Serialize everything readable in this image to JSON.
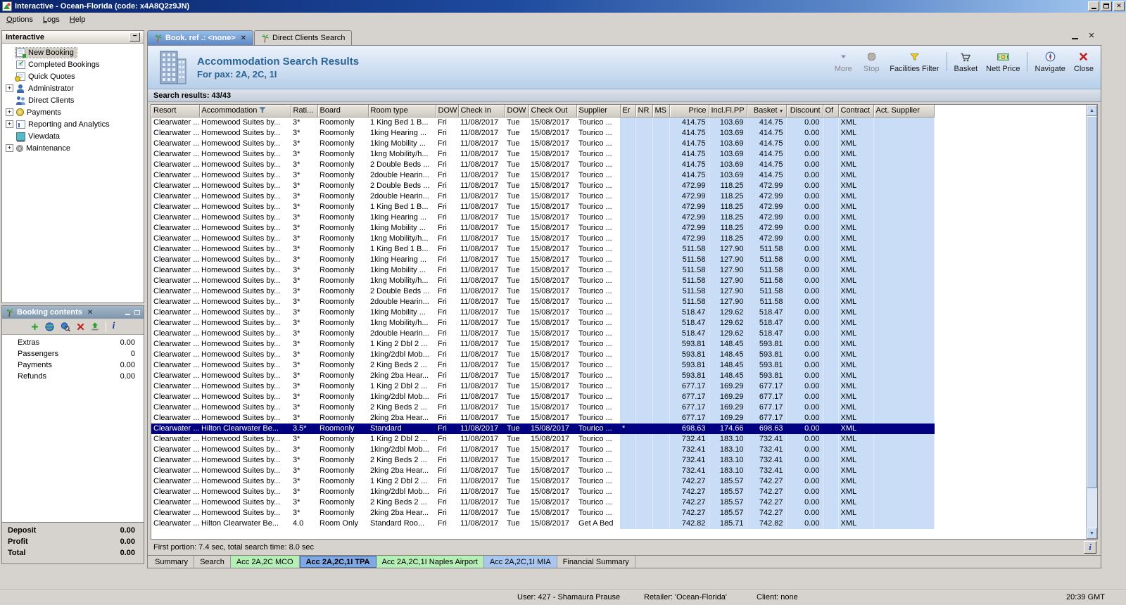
{
  "window": {
    "title": "Interactive - Ocean-Florida (code: x4A8Q2z9JN)"
  },
  "menu": {
    "items": [
      {
        "label": "Options"
      },
      {
        "label": "Logs"
      },
      {
        "label": "Help"
      }
    ]
  },
  "sidebar": {
    "title": "Interactive",
    "items": [
      {
        "label": "New Booking",
        "icon": "booking-form",
        "expandable": false,
        "selected": true
      },
      {
        "label": "Completed Bookings",
        "icon": "completed-form",
        "expandable": false
      },
      {
        "label": "Quick Quotes",
        "icon": "quote-form",
        "expandable": false
      },
      {
        "label": "Administrator",
        "icon": "person",
        "expandable": true
      },
      {
        "label": "Direct Clients",
        "icon": "people",
        "expandable": false
      },
      {
        "label": "Payments",
        "icon": "coin",
        "expandable": true
      },
      {
        "label": "Reporting and Analytics",
        "icon": "chart",
        "expandable": true
      },
      {
        "label": "Viewdata",
        "icon": "monitor",
        "expandable": false
      },
      {
        "label": "Maintenance",
        "icon": "tools",
        "expandable": true
      }
    ]
  },
  "booking": {
    "title": "Booking contents",
    "rows": [
      {
        "label": "Extras",
        "value": "0.00"
      },
      {
        "label": "Passengers",
        "value": "0"
      },
      {
        "label": "Payments",
        "value": "0.00"
      },
      {
        "label": "Refunds",
        "value": "0.00"
      }
    ],
    "totals": [
      {
        "label": "Deposit",
        "value": "0.00"
      },
      {
        "label": "Profit",
        "value": "0.00"
      },
      {
        "label": "Total",
        "value": "0.00"
      }
    ]
  },
  "doc_tabs": {
    "tabs": [
      {
        "label": "Book. ref .: <none>",
        "active": true,
        "closable": true
      },
      {
        "label": "Direct Clients Search",
        "active": false
      }
    ]
  },
  "results": {
    "title": "Accommodation Search Results",
    "subtitle": "For pax: 2A, 2C, 1I",
    "toolbar": [
      {
        "label": "More",
        "disabled": true
      },
      {
        "label": "Stop",
        "disabled": true
      },
      {
        "label": "Facilities Filter",
        "disabled": false
      },
      {
        "label": "Basket",
        "disabled": false
      },
      {
        "label": "Nett Price",
        "disabled": false
      },
      {
        "label": "Navigate",
        "disabled": false
      },
      {
        "label": "Close",
        "disabled": false
      }
    ],
    "summary": "Search results: 43/43",
    "status_line": "First portion: 7.4 sec, total search time: 8.0 sec"
  },
  "icons": {
    "more": "down-arrow",
    "stop": "gray-octagon",
    "facilities_filter": "yellow-funnel",
    "basket": "shopping-cart",
    "nett_price": "banknote",
    "navigate": "compass",
    "close": "red-x",
    "accommodation_header": "filter-funnel",
    "basket_header": "sort-arrow-down",
    "booking_toolbar": [
      "green-plus",
      "globe",
      "globe-search",
      "red-x",
      "export-up-arrow",
      "info-i"
    ],
    "doc_tab": "palm-tree",
    "results_header": "building"
  },
  "table": {
    "columns": [
      "Resort",
      "Accommodation",
      "Rati...",
      "Board",
      "Room type",
      "DOW",
      "Check In",
      "DOW",
      "Check Out",
      "Supplier",
      "Er",
      "NR",
      "MS",
      "Price",
      "Incl.Fl.PP",
      "Basket",
      "Discount",
      "Of",
      "Contract",
      "Act. Supplier"
    ],
    "row_defaults": {
      "resort": "Clearwater ...",
      "accommodation": "Homewood Suites by...",
      "rating": "3*",
      "board": "Roomonly",
      "dow_in": "Fri",
      "check_in": "11/08/2017",
      "dow_out": "Tue",
      "check_out": "15/08/2017",
      "supplier": "Tourico ...",
      "er": "",
      "nr": "",
      "ms": "",
      "discount": "0.00",
      "of": "",
      "contract": "XML",
      "act_supplier": ""
    },
    "selected_index": 29,
    "rows": [
      {
        "room": "1 King Bed 1 B...",
        "price": "414.75",
        "incl": "103.69",
        "basket": "414.75"
      },
      {
        "room": "1king Hearing ...",
        "price": "414.75",
        "incl": "103.69",
        "basket": "414.75"
      },
      {
        "room": "1king Mobility ...",
        "price": "414.75",
        "incl": "103.69",
        "basket": "414.75"
      },
      {
        "room": "1kng Mobility/h...",
        "price": "414.75",
        "incl": "103.69",
        "basket": "414.75"
      },
      {
        "room": "2 Double Beds ...",
        "price": "414.75",
        "incl": "103.69",
        "basket": "414.75"
      },
      {
        "room": "2double Hearin...",
        "price": "414.75",
        "incl": "103.69",
        "basket": "414.75"
      },
      {
        "room": "2 Double Beds ...",
        "price": "472.99",
        "incl": "118.25",
        "basket": "472.99"
      },
      {
        "room": "2double Hearin...",
        "price": "472.99",
        "incl": "118.25",
        "basket": "472.99"
      },
      {
        "room": "1 King Bed 1 B...",
        "price": "472.99",
        "incl": "118.25",
        "basket": "472.99"
      },
      {
        "room": "1king Hearing ...",
        "price": "472.99",
        "incl": "118.25",
        "basket": "472.99"
      },
      {
        "room": "1king Mobility ...",
        "price": "472.99",
        "incl": "118.25",
        "basket": "472.99"
      },
      {
        "room": "1kng Mobility/h...",
        "price": "472.99",
        "incl": "118.25",
        "basket": "472.99"
      },
      {
        "room": "1 King Bed 1 B...",
        "price": "511.58",
        "incl": "127.90",
        "basket": "511.58"
      },
      {
        "room": "1king Hearing ...",
        "price": "511.58",
        "incl": "127.90",
        "basket": "511.58"
      },
      {
        "room": "1king Mobility ...",
        "price": "511.58",
        "incl": "127.90",
        "basket": "511.58"
      },
      {
        "room": "1kng Mobility/h...",
        "price": "511.58",
        "incl": "127.90",
        "basket": "511.58"
      },
      {
        "room": "2 Double Beds ...",
        "price": "511.58",
        "incl": "127.90",
        "basket": "511.58"
      },
      {
        "room": "2double Hearin...",
        "price": "511.58",
        "incl": "127.90",
        "basket": "511.58"
      },
      {
        "room": "1king Mobility ...",
        "price": "518.47",
        "incl": "129.62",
        "basket": "518.47"
      },
      {
        "room": "1kng Mobility/h...",
        "price": "518.47",
        "incl": "129.62",
        "basket": "518.47"
      },
      {
        "room": "2double Hearin...",
        "price": "518.47",
        "incl": "129.62",
        "basket": "518.47"
      },
      {
        "room": "1 King 2 Dbl 2 ...",
        "price": "593.81",
        "incl": "148.45",
        "basket": "593.81"
      },
      {
        "room": "1king/2dbl Mob...",
        "price": "593.81",
        "incl": "148.45",
        "basket": "593.81"
      },
      {
        "room": "2 King Beds 2 ...",
        "price": "593.81",
        "incl": "148.45",
        "basket": "593.81"
      },
      {
        "room": "2king 2ba Hear...",
        "price": "593.81",
        "incl": "148.45",
        "basket": "593.81"
      },
      {
        "room": "1 King 2 Dbl 2 ...",
        "price": "677.17",
        "incl": "169.29",
        "basket": "677.17"
      },
      {
        "room": "1king/2dbl Mob...",
        "price": "677.17",
        "incl": "169.29",
        "basket": "677.17"
      },
      {
        "room": "2 King Beds 2 ...",
        "price": "677.17",
        "incl": "169.29",
        "basket": "677.17"
      },
      {
        "room": "2king 2ba Hear...",
        "price": "677.17",
        "incl": "169.29",
        "basket": "677.17"
      },
      {
        "accommodation": "Hilton Clearwater Be...",
        "rating": "3.5*",
        "room": "Standard",
        "er": "*",
        "price": "698.63",
        "incl": "174.66",
        "basket": "698.63"
      },
      {
        "room": "1 King 2 Dbl 2 ...",
        "price": "732.41",
        "incl": "183.10",
        "basket": "732.41"
      },
      {
        "room": "1king/2dbl Mob...",
        "price": "732.41",
        "incl": "183.10",
        "basket": "732.41"
      },
      {
        "room": "2 King Beds 2 ...",
        "price": "732.41",
        "incl": "183.10",
        "basket": "732.41"
      },
      {
        "room": "2king 2ba Hear...",
        "price": "732.41",
        "incl": "183.10",
        "basket": "732.41"
      },
      {
        "room": "1 King 2 Dbl 2 ...",
        "price": "742.27",
        "incl": "185.57",
        "basket": "742.27"
      },
      {
        "room": "1king/2dbl Mob...",
        "price": "742.27",
        "incl": "185.57",
        "basket": "742.27"
      },
      {
        "room": "2 King Beds 2 ...",
        "price": "742.27",
        "incl": "185.57",
        "basket": "742.27"
      },
      {
        "room": "2king 2ba Hear...",
        "price": "742.27",
        "incl": "185.57",
        "basket": "742.27"
      },
      {
        "accommodation": "Hilton Clearwater Be...",
        "rating": "4.0",
        "board": "Room Only",
        "room": "Standard Roo...",
        "supplier": "Get A Bed",
        "price": "742.82",
        "incl": "185.71",
        "basket": "742.82"
      }
    ]
  },
  "bottom_tabs": {
    "tabs": [
      {
        "label": "Summary",
        "style": "plain"
      },
      {
        "label": "Search",
        "style": "plain"
      },
      {
        "label": "Acc 2A,2C MCO",
        "style": "green"
      },
      {
        "label": "Acc 2A,2C,1I TPA",
        "style": "blue",
        "active": true
      },
      {
        "label": "Acc 2A,2C,1I Naples Airport",
        "style": "green"
      },
      {
        "label": "Acc 2A,2C,1I MIA",
        "style": "blue"
      },
      {
        "label": "Financial Summary",
        "style": "plain"
      }
    ]
  },
  "statusbar": {
    "user": "User: 427 - Shamaura Prause",
    "retailer": "Retailer: 'Ocean-Florida'",
    "client": "Client: none",
    "time": "20:39 GMT"
  }
}
